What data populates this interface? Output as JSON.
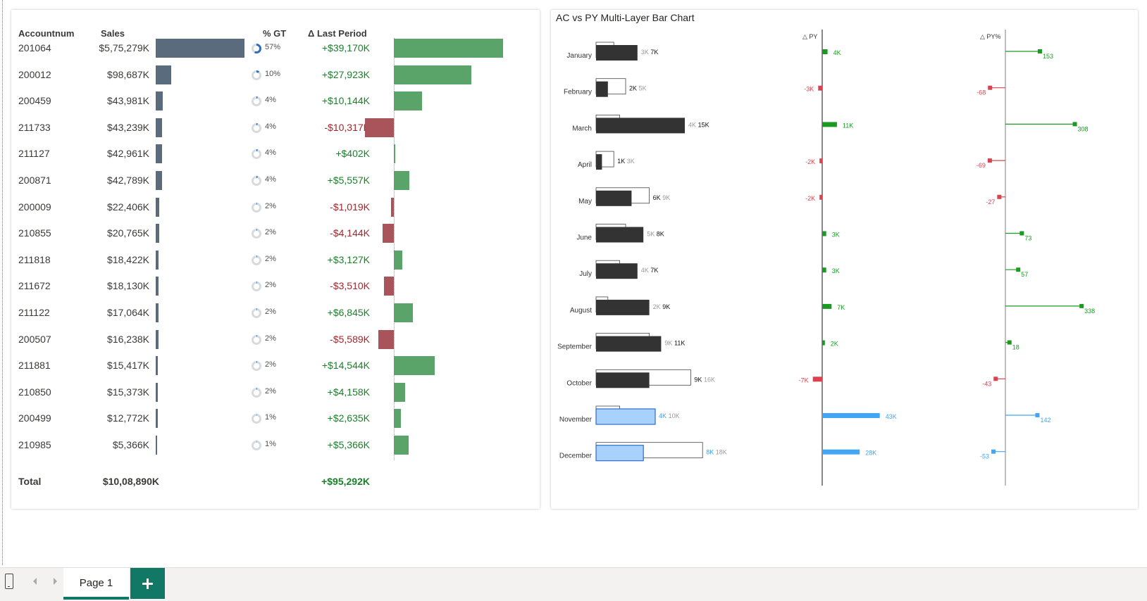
{
  "colors": {
    "sales_bar": "#5a6b7e",
    "positive": "#5aa469",
    "negative": "#a8545a",
    "positive_text": "#1b7f2a",
    "negative_text": "#a4262c",
    "ac_bar": "#333333",
    "forecast_bar": "#a8d1fb",
    "forecast_text": "#3c9ef0",
    "py_pos": "#1a9a23",
    "py_neg": "#d9434f",
    "fc_delta": "#42a5f5",
    "tab_accent": "#117865"
  },
  "table": {
    "headers": {
      "account": "Accountnum",
      "sales": "Sales",
      "pct": "% GT",
      "delta": "Δ Last Period"
    },
    "rows": [
      {
        "account": "201064",
        "sales": "$5,75,279K",
        "sales_value": 575279,
        "pct_label": "57%",
        "pct": 57,
        "delta": "+$39,170K",
        "delta_value": 39170
      },
      {
        "account": "200012",
        "sales": "$98,687K",
        "sales_value": 98687,
        "pct_label": "10%",
        "pct": 10,
        "delta": "+$27,923K",
        "delta_value": 27923
      },
      {
        "account": "200459",
        "sales": "$43,981K",
        "sales_value": 43981,
        "pct_label": "4%",
        "pct": 4,
        "delta": "+$10,144K",
        "delta_value": 10144
      },
      {
        "account": "211733",
        "sales": "$43,239K",
        "sales_value": 43239,
        "pct_label": "4%",
        "pct": 4,
        "delta": "-$10,317K",
        "delta_value": -10317
      },
      {
        "account": "211127",
        "sales": "$42,961K",
        "sales_value": 42961,
        "pct_label": "4%",
        "pct": 4,
        "delta": "+$402K",
        "delta_value": 402
      },
      {
        "account": "200871",
        "sales": "$42,789K",
        "sales_value": 42789,
        "pct_label": "4%",
        "pct": 4,
        "delta": "+$5,557K",
        "delta_value": 5557
      },
      {
        "account": "200009",
        "sales": "$22,406K",
        "sales_value": 22406,
        "pct_label": "2%",
        "pct": 2,
        "delta": "-$1,019K",
        "delta_value": -1019
      },
      {
        "account": "210855",
        "sales": "$20,765K",
        "sales_value": 20765,
        "pct_label": "2%",
        "pct": 2,
        "delta": "-$4,144K",
        "delta_value": -4144
      },
      {
        "account": "211818",
        "sales": "$18,422K",
        "sales_value": 18422,
        "pct_label": "2%",
        "pct": 2,
        "delta": "+$3,127K",
        "delta_value": 3127
      },
      {
        "account": "211672",
        "sales": "$18,130K",
        "sales_value": 18130,
        "pct_label": "2%",
        "pct": 2,
        "delta": "-$3,510K",
        "delta_value": -3510
      },
      {
        "account": "211122",
        "sales": "$17,064K",
        "sales_value": 17064,
        "pct_label": "2%",
        "pct": 2,
        "delta": "+$6,845K",
        "delta_value": 6845
      },
      {
        "account": "200507",
        "sales": "$16,238K",
        "sales_value": 16238,
        "pct_label": "2%",
        "pct": 2,
        "delta": "-$5,589K",
        "delta_value": -5589
      },
      {
        "account": "211881",
        "sales": "$15,417K",
        "sales_value": 15417,
        "pct_label": "2%",
        "pct": 2,
        "delta": "+$14,544K",
        "delta_value": 14544
      },
      {
        "account": "210850",
        "sales": "$15,373K",
        "sales_value": 15373,
        "pct_label": "2%",
        "pct": 2,
        "delta": "+$4,158K",
        "delta_value": 4158
      },
      {
        "account": "200499",
        "sales": "$12,772K",
        "sales_value": 12772,
        "pct_label": "1%",
        "pct": 1,
        "delta": "+$2,635K",
        "delta_value": 2635
      },
      {
        "account": "210985",
        "sales": "$5,366K",
        "sales_value": 5366,
        "pct_label": "1%",
        "pct": 1,
        "delta": "+$5,366K",
        "delta_value": 5366
      }
    ],
    "total": {
      "label": "Total",
      "sales": "$10,08,890K",
      "delta": "+$95,292K"
    }
  },
  "chart_data": {
    "type": "bar",
    "title": "AC vs PY Multi-Layer Bar Chart",
    "categories": [
      "January",
      "February",
      "March",
      "April",
      "May",
      "June",
      "July",
      "August",
      "September",
      "October",
      "November",
      "December"
    ],
    "series": [
      {
        "name": "AC",
        "values": [
          7,
          2,
          15,
          1,
          6,
          8,
          7,
          9,
          11,
          9,
          10,
          8
        ]
      },
      {
        "name": "PY",
        "values": [
          3,
          5,
          4,
          3,
          9,
          5,
          4,
          2,
          9,
          16,
          4,
          18
        ]
      }
    ],
    "ac_labels": [
      "7K",
      "2K",
      "15K",
      "1K",
      "6K",
      "8K",
      "7K",
      "9K",
      "11K",
      "9K",
      "10K",
      "8K"
    ],
    "py_labels": [
      "3K",
      "5K",
      "4K",
      "3K",
      "9K",
      "5K",
      "4K",
      "2K",
      "9K",
      "16K",
      "4K",
      "18K"
    ],
    "forecast_months": [
      "November",
      "December"
    ],
    "delta_py": {
      "header": "△ PY",
      "values": [
        4,
        -3,
        11,
        -2,
        -2,
        3,
        3,
        7,
        2,
        -7,
        43,
        28
      ],
      "labels": [
        "4K",
        "-3K",
        "11K",
        "-2K",
        "-2K",
        "3K",
        "3K",
        "7K",
        "2K",
        "-7K",
        "43K",
        "28K"
      ]
    },
    "delta_py_pct": {
      "header": "△ PY%",
      "values": [
        153,
        -68,
        308,
        -69,
        -27,
        73,
        57,
        338,
        18,
        -43,
        142,
        -53
      ],
      "labels": [
        "153",
        "-68",
        "308",
        "-69",
        "-27",
        "73",
        "57",
        "338",
        "18",
        "-43",
        "142",
        "-53"
      ]
    }
  },
  "tabs": {
    "page1_label": "Page 1",
    "add_label": "+"
  }
}
